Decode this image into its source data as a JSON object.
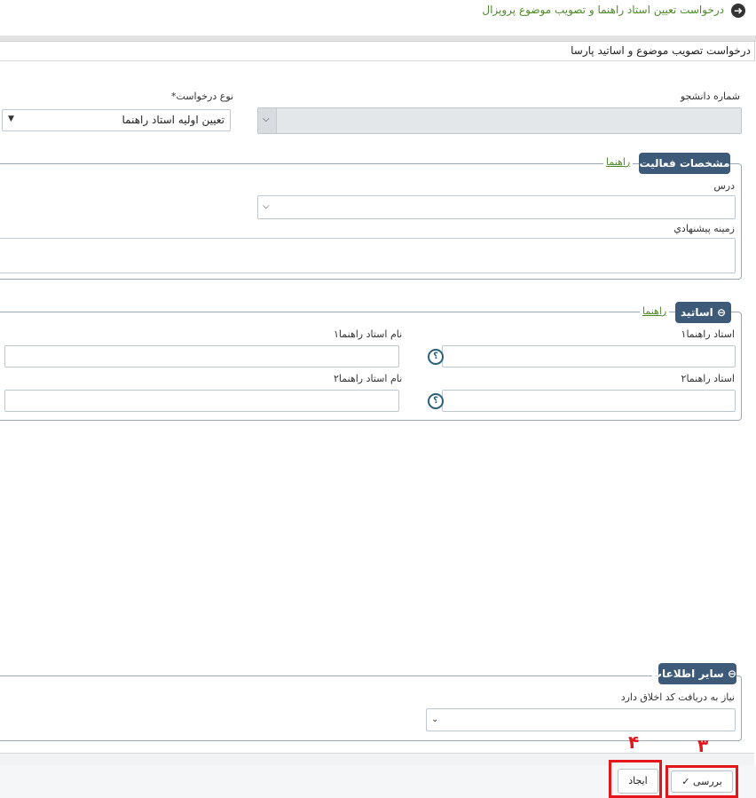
{
  "header": {
    "title": "درخواست تعیین استاد راهنما و تصویب موضوع پروپزال",
    "back_icon": "arrow-left-circle-icon"
  },
  "panel": {
    "title": "درخواست تصویب موضوع و اساتید پارسا"
  },
  "form": {
    "student_number_label": "شماره دانشجو",
    "request_type_label": "نوع درخواست*",
    "request_type_value": "تعیین اولیه استاد راهنما"
  },
  "activity": {
    "legend": "مشخصات فعالیت",
    "guide": "راهنما",
    "course_label": "درس",
    "proposed_field_label": "زمینه پیشنهادي"
  },
  "advisors": {
    "legend": "اساتید",
    "guide": "راهنما",
    "advisor1_label": "استاد راهنما۱",
    "advisor1_name_label": "نام استاد راهنما۱",
    "advisor2_label": "استاد راهنما۲",
    "advisor2_name_label": "نام استاد راهنما۲",
    "help_symbol": "؟"
  },
  "other": {
    "legend": "سایر اطلاعات",
    "ethics_label": "نیاز به دریافت کد اخلاق دارد"
  },
  "buttons": {
    "review_label": "بررسی",
    "create_label": "ایجاد"
  },
  "annotations": {
    "review_number": "۳",
    "create_number": "۴",
    "highlight_color": "#e4161c"
  },
  "colors": {
    "accent": "#3d5a78",
    "link": "#4e8a2a"
  }
}
